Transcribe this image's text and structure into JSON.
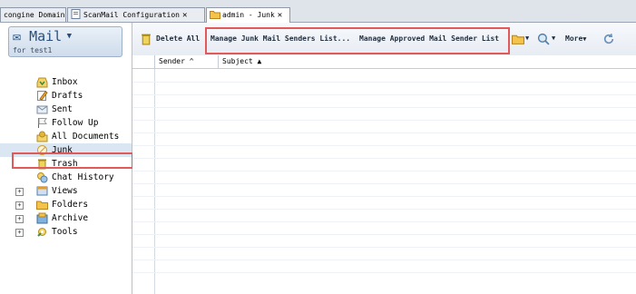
{
  "tabs": [
    {
      "label": "congine Domain",
      "closable": false,
      "active": false
    },
    {
      "label": "ScanMail Configuration",
      "closable": true,
      "active": false
    },
    {
      "label": "admin - Junk",
      "closable": true,
      "active": true
    }
  ],
  "mail": {
    "title": "Mail",
    "subtitle": "for test1"
  },
  "nav": [
    {
      "label": "Inbox",
      "icon": "inbox-icon",
      "expandable": false
    },
    {
      "label": "Drafts",
      "icon": "drafts-icon",
      "expandable": false
    },
    {
      "label": "Sent",
      "icon": "sent-icon",
      "expandable": false
    },
    {
      "label": "Follow Up",
      "icon": "flag-icon",
      "expandable": false
    },
    {
      "label": "All Documents",
      "icon": "documents-icon",
      "expandable": false
    },
    {
      "label": "Junk",
      "icon": "junk-icon",
      "expandable": false,
      "selected": true
    },
    {
      "label": "Trash",
      "icon": "trash-icon",
      "expandable": false
    },
    {
      "label": "Chat History",
      "icon": "chat-icon",
      "expandable": false
    },
    {
      "label": "Views",
      "icon": "views-icon",
      "expandable": true
    },
    {
      "label": "Folders",
      "icon": "folder-icon",
      "expandable": true
    },
    {
      "label": "Archive",
      "icon": "archive-icon",
      "expandable": true
    },
    {
      "label": "Tools",
      "icon": "tools-icon",
      "expandable": true
    }
  ],
  "toolbar": {
    "delete_all": "Delete All",
    "manage_junk": "Manage Junk Mail Senders List...",
    "manage_approved": "Manage Approved Mail Sender List",
    "more": "More"
  },
  "columns": {
    "sender": "Sender",
    "subject": "Subject"
  },
  "colors": {
    "highlight": "#e05a5a",
    "selected_row": "#dbe6f3",
    "mail_title": "#2a4f7e"
  }
}
